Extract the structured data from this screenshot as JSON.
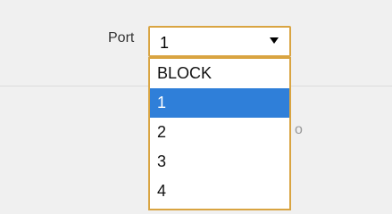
{
  "port_field": {
    "label": "Port",
    "selected_value": "1",
    "arrow_icon": "triangle-down-icon",
    "accent_color": "#d9a441"
  },
  "dropdown": {
    "options": [
      "BLOCK",
      "1",
      "2",
      "3",
      "4"
    ],
    "highlighted_option": "1",
    "highlight_color": "#2f7fd9"
  },
  "background_text": {
    "partial_visible": "o"
  }
}
